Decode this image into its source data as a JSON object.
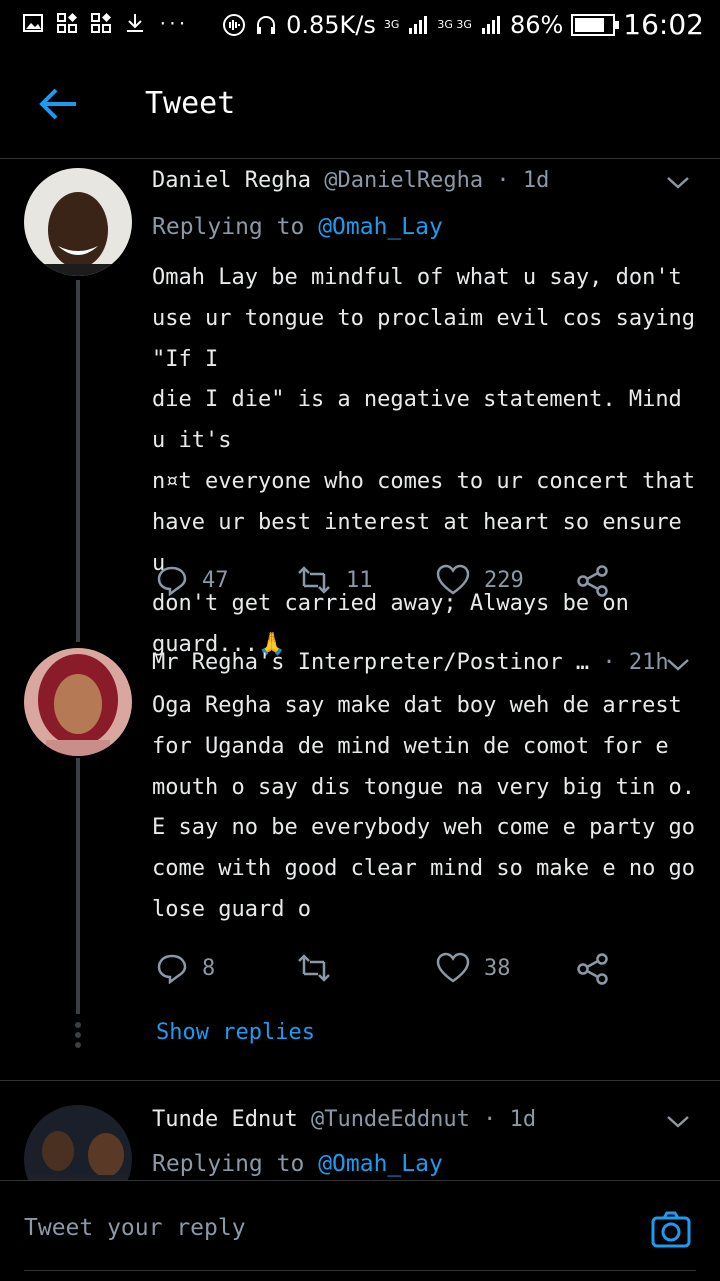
{
  "status_bar": {
    "network_speed": "0.85K/s",
    "sim1": "3G",
    "sim2": "3G 3G",
    "battery": "86%",
    "battery_level": 0.86,
    "time": "16:02"
  },
  "header": {
    "title": "Tweet"
  },
  "tweets": [
    {
      "name": "Daniel Regha",
      "handle": "@DanielRegha",
      "time": "1d",
      "replying_label": "Replying to",
      "replying_to": "@Omah_Lay",
      "body": "Omah Lay be mindful of what u say, don't\nuse ur tongue to proclaim evil cos saying \"If I\ndie I die\" is a negative statement. Mind u it's\nn¤t everyone who comes to ur concert that\nhave ur best interest at heart so ensure u\ndon't get carried away; Always be on\nguard...🙏",
      "replies": "47",
      "retweets": "11",
      "likes": "229"
    },
    {
      "name": "Mr Regha's Interpreter/Postinor …",
      "time": "21h",
      "body": "Oga Regha say make dat boy weh de arrest\nfor Uganda de mind wetin de comot for e\nmouth o say dis tongue na very big tin o.\nE say no be everybody weh come e party go\ncome with good clear mind so make e no go\nlose guard o",
      "replies": "8",
      "likes": "38",
      "show_replies": "Show replies"
    },
    {
      "name": "Tunde Ednut",
      "handle": "@TundeEddnut",
      "time": "1d",
      "replying_label": "Replying to",
      "replying_to": "@Omah_Lay"
    }
  ],
  "composer": {
    "placeholder": "Tweet your reply"
  },
  "colors": {
    "accent": "#1d9bf0",
    "background": "#000000",
    "muted": "#8b98a5"
  }
}
